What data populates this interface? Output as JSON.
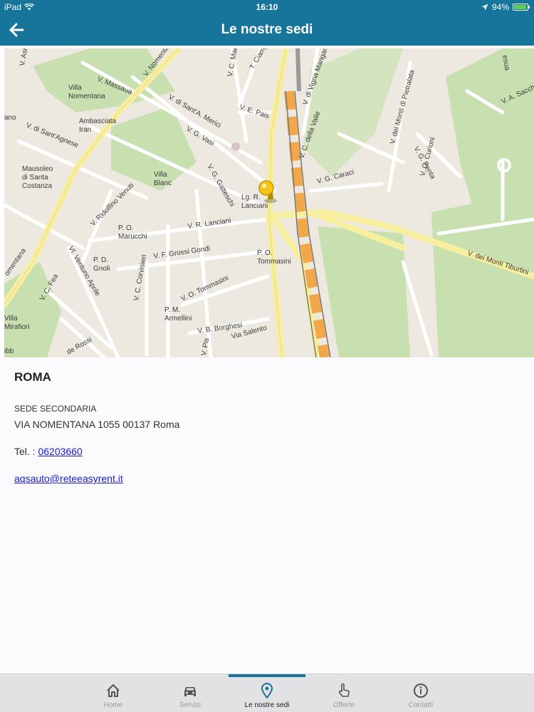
{
  "status_bar": {
    "device": "iPad",
    "time": "16:10",
    "battery": "94%",
    "battery_level": 0.94
  },
  "header": {
    "title": "Le nostre sedi"
  },
  "map": {
    "labels": [
      "V. Nomentana",
      "V. Massaua",
      "Villa Nomentana",
      "V. di Sant'A. Merici",
      "V. G. Vasi",
      "Ambasciata Iran",
      "ano",
      "V. di Sant'Agnese",
      "Mausoleo di Santa Costanza",
      "Villa Blanc",
      "V. C. Maes",
      "T. Ciampi",
      "V. E. Pais",
      "V. di Vigna Mangani",
      "V. C. della Valle",
      "V. G. Caraci",
      "V. dei Monti di Pietralata",
      "V. G. Curioni",
      "V. G. Penta",
      "V. A. Sacchi",
      "V. G. Gatteschi",
      "Lg. R. Lanciani",
      "V. Ridolfino Venuti",
      "V. R. Lanciani",
      "P. O. Marucchi",
      "V. F. Grossi Gondi",
      "P. O. Tommasini",
      "Vl. Ventuno Aprile",
      "P. D. Gnoli",
      "V. C. Corvisieri",
      "V. O. Tommasini",
      "P. M. Armellini",
      "V. B. Borghesi",
      "Via Salento",
      "V. C. Fea",
      "Villa Mirafiori",
      "de Rossi",
      "V. dei Monti Tiburtini",
      "esua",
      "V. Asm",
      "V. Pis",
      "ibb",
      "omentana"
    ]
  },
  "location": {
    "city": "ROMA",
    "type": "SEDE SECONDARIA",
    "address": "VIA NOMENTANA 1055 00137 Roma",
    "tel_label": "Tel. :",
    "tel": "06203660",
    "email": "aqsauto@reteeasyrent.it"
  },
  "tabs": [
    {
      "label": "Home",
      "icon": "home-icon"
    },
    {
      "label": "Servizi",
      "icon": "car-icon"
    },
    {
      "label": "Le nostre sedi",
      "icon": "location-pin-icon",
      "active": true
    },
    {
      "label": "Offerte",
      "icon": "hand-pointer-icon"
    },
    {
      "label": "Contatti",
      "icon": "info-icon"
    }
  ],
  "colors": {
    "accent": "#17749a",
    "link": "#1a1ad0",
    "map_park": "#c8dfb0",
    "map_major_road": "#f7eea0",
    "map_railway": "#f2a74b"
  }
}
